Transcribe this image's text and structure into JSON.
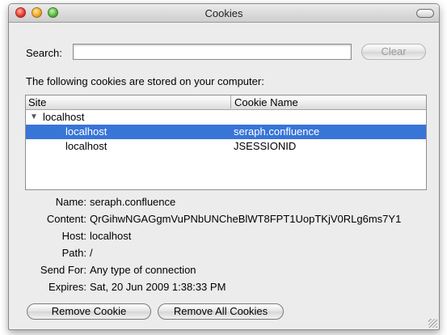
{
  "window": {
    "title": "Cookies"
  },
  "search": {
    "label": "Search:",
    "value": "",
    "placeholder": "",
    "clear_label": "Clear"
  },
  "intro_text": "The following cookies are stored on your computer:",
  "table": {
    "headers": {
      "site": "Site",
      "cookie_name": "Cookie Name"
    },
    "groups": [
      {
        "label": "localhost",
        "expanded": true,
        "rows": [
          {
            "site": "localhost",
            "cookie_name": "seraph.confluence",
            "selected": true
          },
          {
            "site": "localhost",
            "cookie_name": "JSESSIONID",
            "selected": false
          }
        ]
      }
    ]
  },
  "details": {
    "name": {
      "label": "Name:",
      "value": "seraph.confluence"
    },
    "content": {
      "label": "Content:",
      "value": "QrGihwNGAGgmVuPNbUNCheBlWT8FPT1UopTKjV0RLg6ms7Y1"
    },
    "host": {
      "label": "Host:",
      "value": "localhost"
    },
    "path": {
      "label": "Path:",
      "value": "/"
    },
    "send_for": {
      "label": "Send For:",
      "value": "Any type of connection"
    },
    "expires": {
      "label": "Expires:",
      "value": "Sat, 20 Jun 2009 1:38:33 PM"
    }
  },
  "buttons": {
    "remove_cookie": "Remove Cookie",
    "remove_all": "Remove All Cookies"
  },
  "colors": {
    "selection": "#3875d7",
    "window_bg": "#ececec"
  }
}
